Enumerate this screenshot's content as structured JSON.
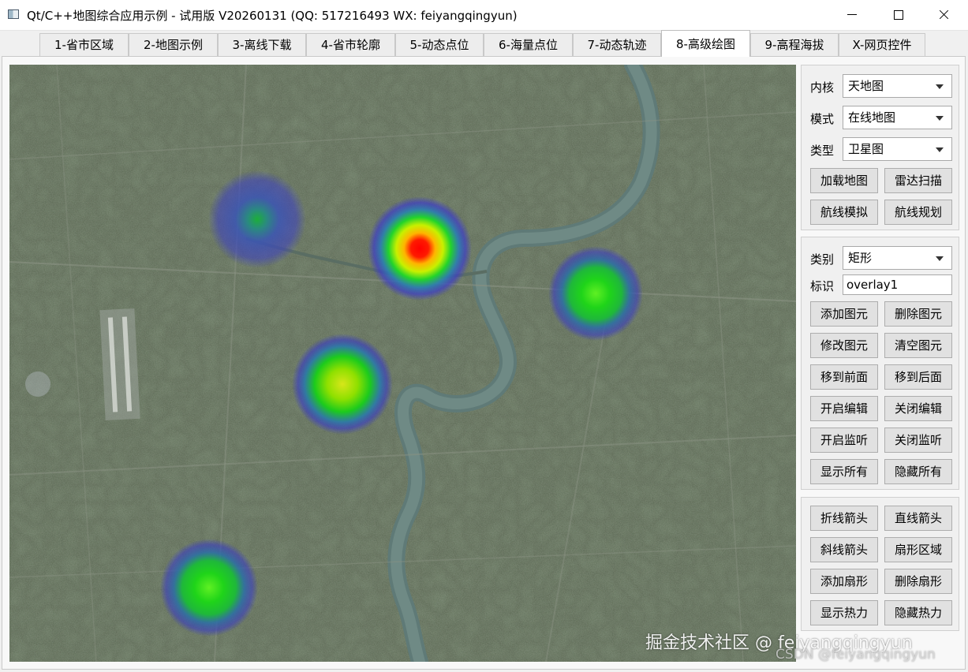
{
  "window": {
    "title": "Qt/C++地图综合应用示例 - 试用版 V20260131 (QQ: 517216493 WX: feiyangqingyun)"
  },
  "tabs": [
    {
      "label": "1-省市区域"
    },
    {
      "label": "2-地图示例"
    },
    {
      "label": "3-离线下载"
    },
    {
      "label": "4-省市轮廓"
    },
    {
      "label": "5-动态点位"
    },
    {
      "label": "6-海量点位"
    },
    {
      "label": "7-动态轨迹"
    },
    {
      "label": "8-高级绘图",
      "active": true
    },
    {
      "label": "9-高程海拔"
    },
    {
      "label": "X-网页控件"
    }
  ],
  "map": {
    "watermark": "掘金技术社区 @ feiyangqingyun",
    "csdn_watermark": "CSDN @feiyangqingyun",
    "heat_colors": [
      "#ff0000",
      "#ffff00",
      "#00ff00",
      "#0000ff"
    ]
  },
  "panel1": {
    "core_label": "内核",
    "core_value": "天地图",
    "mode_label": "模式",
    "mode_value": "在线地图",
    "type_label": "类型",
    "type_value": "卫星图",
    "buttons": [
      "加载地图",
      "雷达扫描",
      "航线模拟",
      "航线规划"
    ]
  },
  "panel2": {
    "category_label": "类别",
    "category_value": "矩形",
    "id_label": "标识",
    "id_value": "overlay1",
    "buttons": [
      "添加图元",
      "删除图元",
      "修改图元",
      "清空图元",
      "移到前面",
      "移到后面",
      "开启编辑",
      "关闭编辑",
      "开启监听",
      "关闭监听",
      "显示所有",
      "隐藏所有"
    ]
  },
  "panel3": {
    "buttons": [
      "折线箭头",
      "直线箭头",
      "斜线箭头",
      "扇形区域",
      "添加扇形",
      "删除扇形",
      "显示热力",
      "隐藏热力"
    ]
  }
}
